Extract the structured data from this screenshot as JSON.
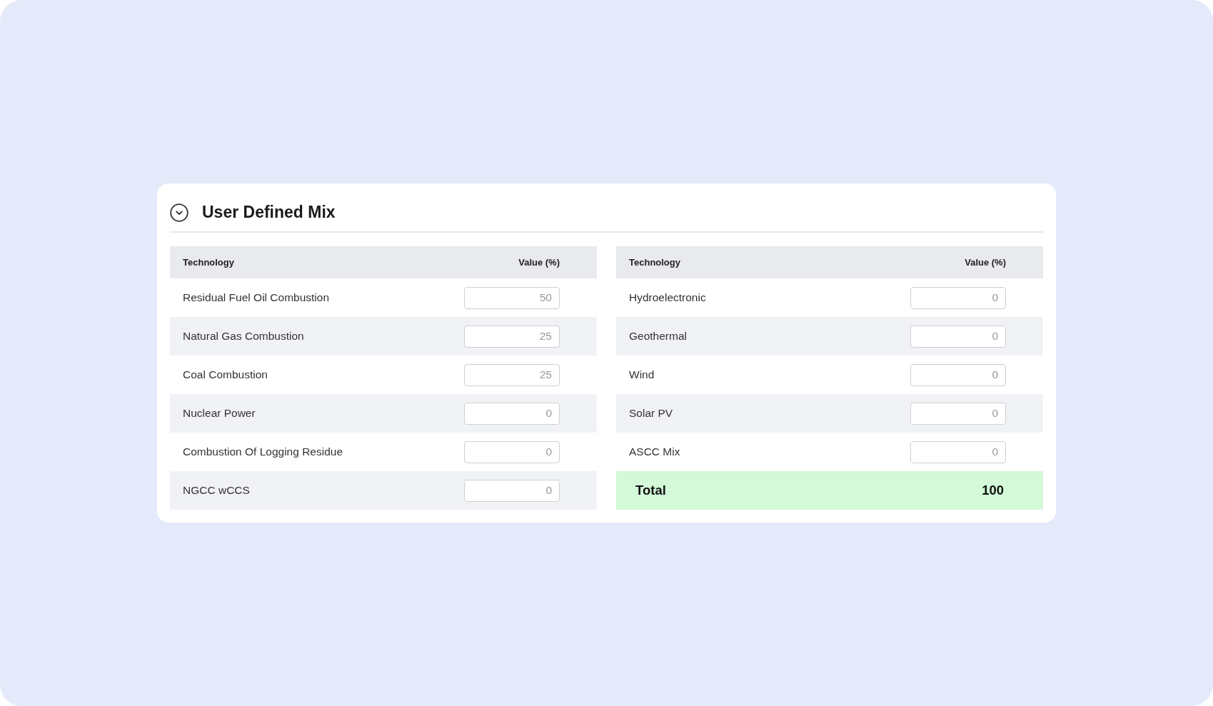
{
  "panel": {
    "title": "User Defined Mix",
    "expanded": true
  },
  "tables": [
    {
      "columns": [
        "Technology",
        "Value (%)"
      ],
      "rows": [
        {
          "technology": "Residual Fuel Oil Combustion",
          "value": "50"
        },
        {
          "technology": "Natural Gas Combustion",
          "value": "25"
        },
        {
          "technology": "Coal Combustion",
          "value": "25"
        },
        {
          "technology": "Nuclear Power",
          "value": "0"
        },
        {
          "technology": "Combustion Of Logging Residue",
          "value": "0"
        },
        {
          "technology": "NGCC wCCS",
          "value": "0"
        }
      ]
    },
    {
      "columns": [
        "Technology",
        "Value (%)"
      ],
      "rows": [
        {
          "technology": "Hydroelectronic",
          "value": "0"
        },
        {
          "technology": "Geothermal",
          "value": "0"
        },
        {
          "technology": "Wind",
          "value": "0"
        },
        {
          "technology": "Solar PV",
          "value": "0"
        },
        {
          "technology": "ASCC Mix",
          "value": "0"
        }
      ],
      "total": {
        "label": "Total",
        "value": "100"
      }
    }
  ]
}
